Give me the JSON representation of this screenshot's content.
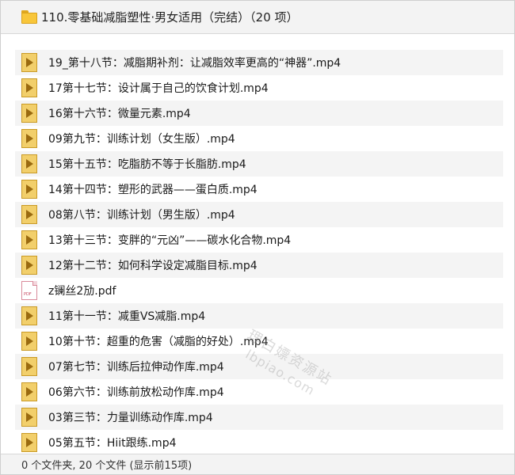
{
  "title": "110.零基础减脂塑性·男女适用（完结）（20 项）",
  "files": [
    {
      "name": "19_第十八节：减脂期补剂：让减脂效率更高的“神器”.mp4",
      "type": "video"
    },
    {
      "name": "17第十七节：设计属于自己的饮食计划.mp4",
      "type": "video"
    },
    {
      "name": "16第十六节：微量元素.mp4",
      "type": "video"
    },
    {
      "name": "09第九节：训练计划（女生版）.mp4",
      "type": "video"
    },
    {
      "name": "15第十五节：吃脂肪不等于长脂肪.mp4",
      "type": "video"
    },
    {
      "name": "14第十四节：塑形的武器——蛋白质.mp4",
      "type": "video"
    },
    {
      "name": "08第八节：训练计划（男生版）.mp4",
      "type": "video"
    },
    {
      "name": "13第十三节：变胖的“元凶”——碳水化合物.mp4",
      "type": "video"
    },
    {
      "name": "12第十二节：如何科学设定减脂目标.mp4",
      "type": "video"
    },
    {
      "name": "z镧丝2劢.pdf",
      "type": "pdf",
      "icon_label": "PDF"
    },
    {
      "name": "11第十一节：减重VS减脂.mp4",
      "type": "video"
    },
    {
      "name": "10第十节：超重的危害（减脂的好处）.mp4",
      "type": "video"
    },
    {
      "name": "07第七节：训练后拉伸动作库.mp4",
      "type": "video"
    },
    {
      "name": "06第六节：训练前放松动作库.mp4",
      "type": "video"
    },
    {
      "name": "03第三节：力量训练动作库.mp4",
      "type": "video"
    },
    {
      "name": "05第五节：Hiit跟练.mp4",
      "type": "video"
    }
  ],
  "watermark": {
    "line1": "理白嫖资源站",
    "line2": "lbpiao.com"
  },
  "status": "0 个文件夹, 20 个文件 (显示前15项)"
}
